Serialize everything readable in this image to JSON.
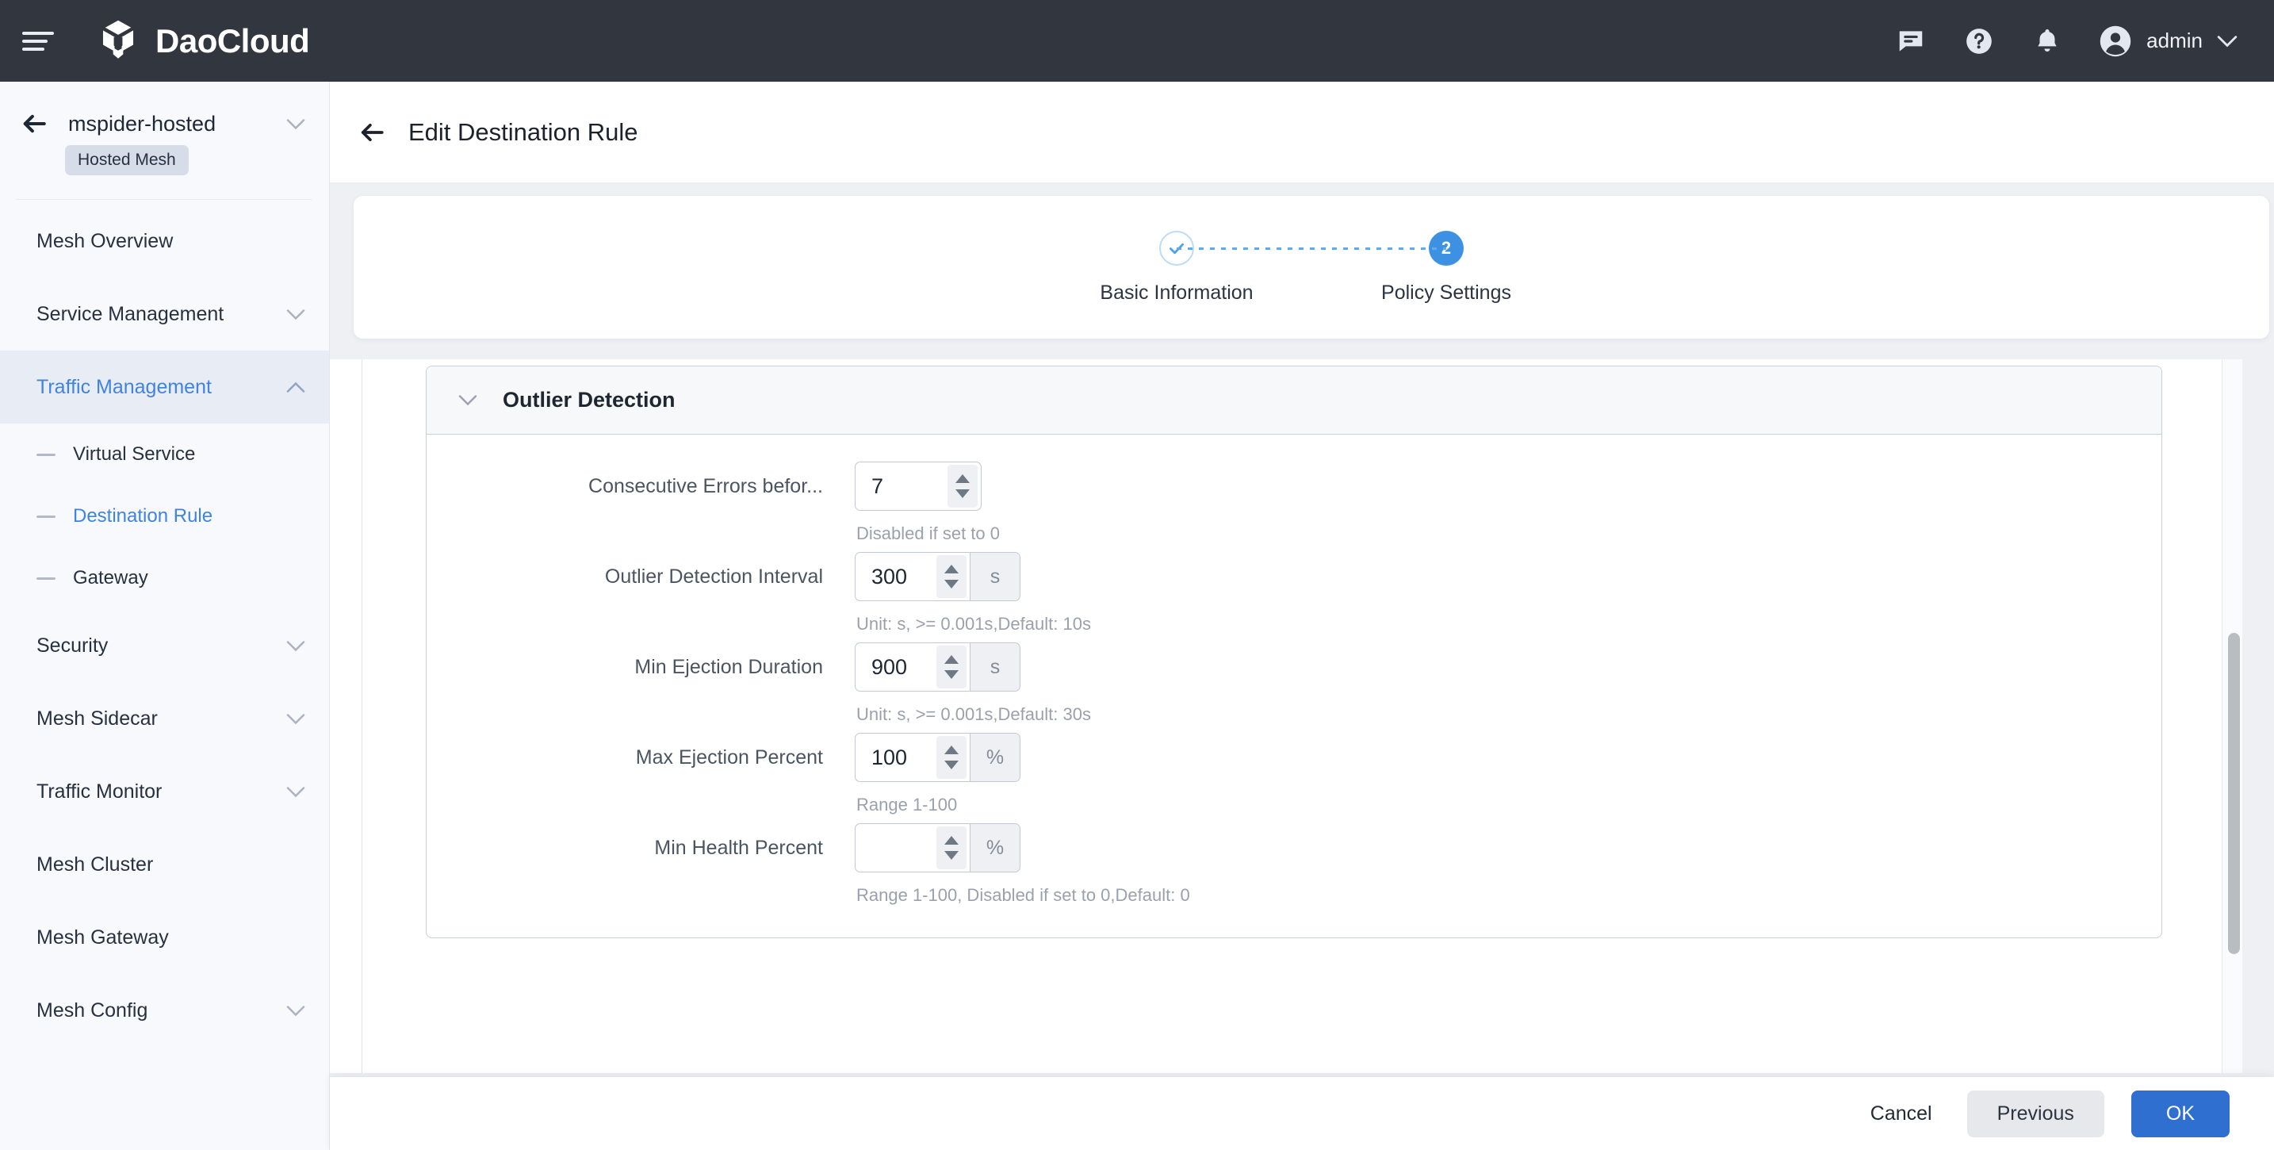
{
  "topbar": {
    "brand_name": "DaoCloud",
    "user_name": "admin",
    "icons": [
      "menu-icon",
      "chat-icon",
      "help-icon",
      "bell-icon",
      "avatar-icon",
      "chevron-down-icon"
    ]
  },
  "sidebar": {
    "mesh_name": "mspider-hosted",
    "mesh_badge": "Hosted Mesh",
    "items": [
      {
        "label": "Mesh Overview",
        "expandable": false,
        "active": false
      },
      {
        "label": "Service Management",
        "expandable": true,
        "active": false
      },
      {
        "label": "Traffic Management",
        "expandable": true,
        "active": true
      },
      {
        "label": "Security",
        "expandable": true,
        "active": false
      },
      {
        "label": "Mesh Sidecar",
        "expandable": true,
        "active": false
      },
      {
        "label": "Traffic Monitor",
        "expandable": true,
        "active": false
      },
      {
        "label": "Mesh Cluster",
        "expandable": false,
        "active": false
      },
      {
        "label": "Mesh Gateway",
        "expandable": false,
        "active": false
      },
      {
        "label": "Mesh Config",
        "expandable": true,
        "active": false
      }
    ],
    "sub_items": [
      {
        "label": "Virtual Service",
        "active": false
      },
      {
        "label": "Destination Rule",
        "active": true
      },
      {
        "label": "Gateway",
        "active": false
      }
    ]
  },
  "page": {
    "title": "Edit Destination Rule"
  },
  "stepper": {
    "steps": [
      {
        "number": "1",
        "label": "Basic Information",
        "state": "done"
      },
      {
        "number": "2",
        "label": "Policy Settings",
        "state": "current"
      }
    ]
  },
  "form": {
    "section_title": "Outlier Detection",
    "fields": [
      {
        "label": "Consecutive Errors befor...",
        "value": "7",
        "placeholder": "",
        "unit": "",
        "hint": "Disabled if set to 0"
      },
      {
        "label": "Outlier Detection Interval",
        "value": "300",
        "placeholder": "",
        "unit": "s",
        "hint": "Unit: s, >= 0.001s,Default: 10s"
      },
      {
        "label": "Min Ejection Duration",
        "value": "900",
        "placeholder": "",
        "unit": "s",
        "hint": "Unit: s, >= 0.001s,Default: 30s"
      },
      {
        "label": "Max Ejection Percent",
        "value": "100",
        "placeholder": "",
        "unit": "%",
        "hint": "Range 1-100"
      },
      {
        "label": "Min Health Percent",
        "value": "",
        "placeholder": "",
        "unit": "%",
        "hint": "Range 1-100, Disabled if set to 0,Default: 0"
      }
    ]
  },
  "footer": {
    "cancel": "Cancel",
    "previous": "Previous",
    "ok": "OK"
  },
  "colors": {
    "topbar_bg": "#32363e",
    "accent_blue": "#4083e0",
    "primary_button": "#2f6fd0",
    "step_current": "#3d91e3",
    "sidebar_bg": "#f7f9fc"
  }
}
